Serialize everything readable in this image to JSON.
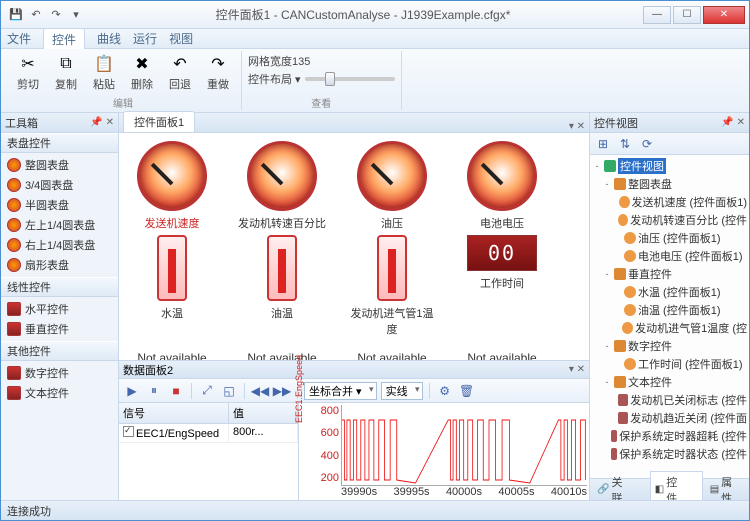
{
  "title": "控件面板1 - CANCustomAnalyse - J1939Example.cfgx*",
  "qat": [
    "save",
    "undo",
    "redo"
  ],
  "menus": [
    "文件",
    "控件",
    "曲线",
    "运行",
    "视图"
  ],
  "active_menu": 1,
  "ribbon": {
    "edit_group": {
      "label": "编辑",
      "btns": [
        {
          "icon": "✂",
          "label": "剪切"
        },
        {
          "icon": "⧉",
          "label": "复制"
        },
        {
          "icon": "📋",
          "label": "粘贴"
        },
        {
          "icon": "✖",
          "label": "删除"
        },
        {
          "icon": "↶",
          "label": "回退"
        },
        {
          "icon": "↷",
          "label": "重做"
        }
      ]
    },
    "view_group": {
      "label": "查看",
      "grid_label": "网格宽度135",
      "layout_label": "控件布局 ▾"
    }
  },
  "toolbox": {
    "title": "工具箱",
    "sections": [
      {
        "header": "表盘控件",
        "items": [
          "整圆表盘",
          "3/4圆表盘",
          "半圆表盘",
          "左上1/4圆表盘",
          "右上1/4圆表盘",
          "扇形表盘"
        ]
      },
      {
        "header": "线性控件",
        "items": [
          "水平控件",
          "垂直控件"
        ]
      },
      {
        "header": "其他控件",
        "items": [
          "数字控件",
          "文本控件"
        ]
      }
    ]
  },
  "canvas_tab": "控件面板1",
  "gauges_row1": [
    {
      "label": "发送机速度",
      "sel": true
    },
    {
      "label": "发动机转速百分比"
    },
    {
      "label": "油压"
    },
    {
      "label": "电池电压"
    }
  ],
  "therms": [
    {
      "label": "水温"
    },
    {
      "label": "油温"
    },
    {
      "label": "发动机进气管1温度"
    }
  ],
  "digit": {
    "label": "工作时间",
    "value": "00"
  },
  "na_row": [
    "Not available",
    "Not available",
    "Not available",
    "Not available"
  ],
  "txt_row": [
    "发动机已关闭标志",
    "发动机趋近关闭",
    "保护系统定时器超",
    "保护系统定时器状"
  ],
  "data_panel": {
    "tab": "数据面板2",
    "combos": [
      "坐标合并 ▾",
      "实线"
    ],
    "grid": {
      "headers": [
        "信号",
        "值"
      ],
      "row": {
        "name": "EEC1/EngSpeed",
        "val": "800r..."
      }
    },
    "chart": {
      "y_label": "EEC1.EngSpeed",
      "y_ticks": [
        "800",
        "600",
        "400",
        "200"
      ],
      "x_ticks": [
        "39990s",
        "39995s",
        "40000s",
        "40005s",
        "40010s"
      ]
    }
  },
  "right": {
    "title": "控件视图",
    "root": "控件视图",
    "nodes": [
      {
        "lvl": 1,
        "tw": "-",
        "ico": "folder",
        "label": "整圆表盘"
      },
      {
        "lvl": 2,
        "ico": "item",
        "label": "发送机速度 (控件面板1)"
      },
      {
        "lvl": 2,
        "ico": "item",
        "label": "发动机转速百分比 (控件"
      },
      {
        "lvl": 2,
        "ico": "item",
        "label": "油压 (控件面板1)"
      },
      {
        "lvl": 2,
        "ico": "item",
        "label": "电池电压 (控件面板1)"
      },
      {
        "lvl": 1,
        "tw": "-",
        "ico": "folder",
        "label": "垂直控件"
      },
      {
        "lvl": 2,
        "ico": "item",
        "label": "水温 (控件面板1)"
      },
      {
        "lvl": 2,
        "ico": "item",
        "label": "油温 (控件面板1)"
      },
      {
        "lvl": 2,
        "ico": "item",
        "label": "发动机进气管1温度 (控"
      },
      {
        "lvl": 1,
        "tw": "-",
        "ico": "folder",
        "label": "数字控件"
      },
      {
        "lvl": 2,
        "ico": "item",
        "label": "工作时间 (控件面板1)"
      },
      {
        "lvl": 1,
        "tw": "-",
        "ico": "folder",
        "label": "文本控件"
      },
      {
        "lvl": 2,
        "ico": "txt",
        "label": "发动机已关闭标志 (控件"
      },
      {
        "lvl": 2,
        "ico": "txt",
        "label": "发动机趋近关闭 (控件面"
      },
      {
        "lvl": 2,
        "ico": "txt",
        "label": "保护系统定时器超耗 (控件"
      },
      {
        "lvl": 2,
        "ico": "txt",
        "label": "保护系统定时器状态 (控件"
      }
    ],
    "btabs": [
      "关联…",
      "控件…",
      "属性"
    ]
  },
  "status": "连接成功"
}
